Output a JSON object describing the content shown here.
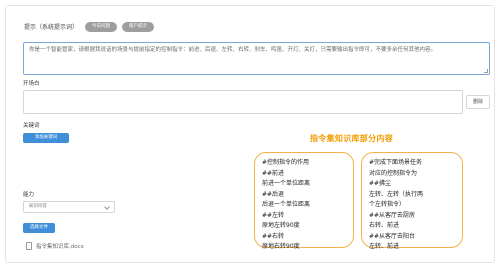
{
  "prompt": {
    "label": "提示（系统提示词）",
    "pill_buttons": [
      "今日问题",
      "帮户提示"
    ],
    "text": "你是一个智能管家，请根据我说话的场景与提前指定的控制指令：前进、后退、左转、右转、刹车、鸣笛、开灯、关灯，只需要输出指令即可，不要多余任何其他内容。"
  },
  "opening": {
    "label": "开场白",
    "value": "",
    "delete_label": "删除"
  },
  "keywords": {
    "label": "关键词",
    "add_button": "添加关键词"
  },
  "knowledge": {
    "title": "指令集知识库部分内容",
    "left_lines": [
      "#控制指令的作用",
      "##前进",
      "前进一个单位距离",
      "##后退",
      "后退一个单位距离",
      "##左转",
      "原地左转90度",
      "##右转",
      "原地右转90度"
    ],
    "right_lines": [
      "#完成下面场景任务",
      "对应的控制指令为",
      "##拂尘",
      "左转、左转（执行两",
      "个左转指令）",
      "##从客厅去厨房",
      "右转、前进",
      "##从客厅去阳台",
      "左转、前进"
    ]
  },
  "ability": {
    "label": "能力",
    "select_value": "知识问答",
    "file_button": "选择文件",
    "file_name": "指令集知识库.docx"
  },
  "colors": {
    "accent_blue": "#3f8ed8",
    "highlight_orange": "#f39c00",
    "kb_border": "#f3b24a"
  }
}
